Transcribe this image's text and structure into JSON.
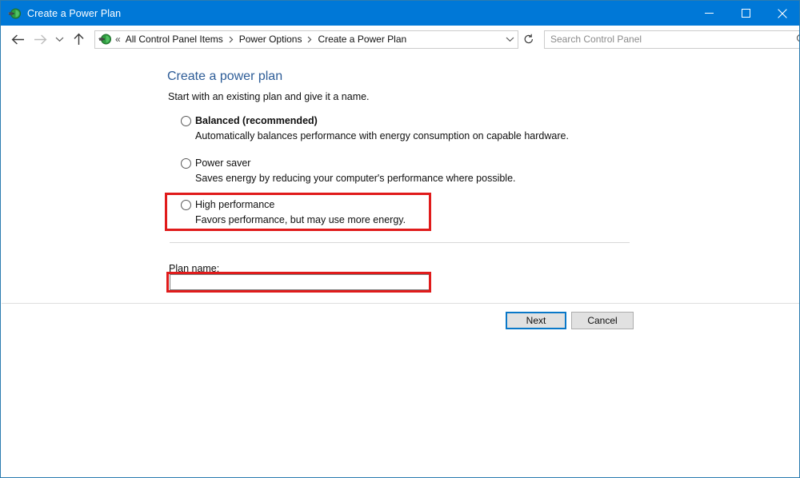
{
  "window": {
    "title": "Create a Power Plan",
    "app_icon": "power-plug-icon",
    "minimize_label": "Minimize",
    "maximize_label": "Maximize",
    "close_label": "Close",
    "border_color": "#2c7cb0",
    "titlebar_color": "#0078d7"
  },
  "navbar": {
    "back_label": "Back",
    "forward_label": "Forward",
    "recent_label": "Recent locations",
    "up_label": "Up one level",
    "refresh_label": "Refresh",
    "overflow": "«",
    "crumbs": [
      "All Control Panel Items",
      "Power Options",
      "Create a Power Plan"
    ],
    "search": {
      "placeholder": "Search Control Panel",
      "value": ""
    }
  },
  "main": {
    "title": "Create a power plan",
    "subtitle": "Start with an existing plan and give it a name.",
    "options": [
      {
        "label": "Balanced (recommended)",
        "description": "Automatically balances performance with energy consumption on capable hardware.",
        "selected": false,
        "bold": true
      },
      {
        "label": "Power saver",
        "description": "Saves energy by reducing your computer's performance where possible.",
        "selected": false,
        "bold": false
      },
      {
        "label": "High performance",
        "description": "Favors performance, but may use more energy.",
        "selected": false,
        "bold": false
      }
    ],
    "plan_name_label": "Plan name:",
    "plan_name_value": "",
    "plan_name_placeholder": ""
  },
  "footer": {
    "next_label": "Next",
    "cancel_label": "Cancel"
  },
  "annotations": {
    "color": "#e01b1b",
    "highlight_high_performance": "High performance option highlighted",
    "highlight_plan_name": "Plan name field highlighted"
  }
}
